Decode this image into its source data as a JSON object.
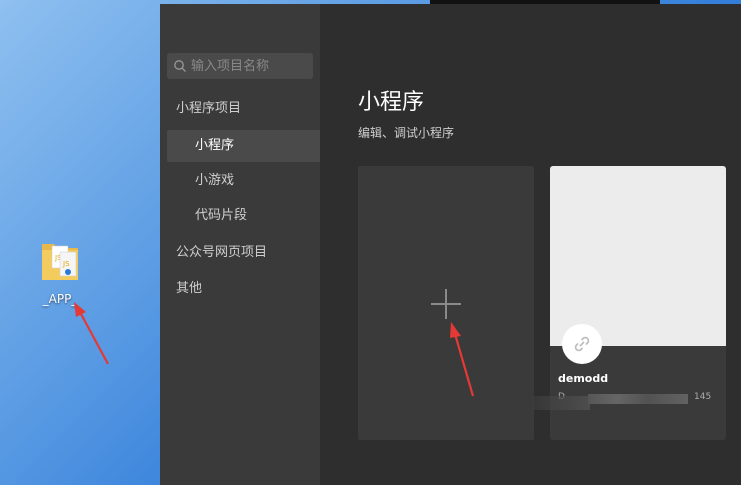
{
  "desktop": {
    "icon_label": "_APP_"
  },
  "sidebar": {
    "search_placeholder": "输入项目名称",
    "items": [
      {
        "label": "小程序项目"
      },
      {
        "label": "小程序"
      },
      {
        "label": "小游戏"
      },
      {
        "label": "代码片段"
      },
      {
        "label": "公众号网页项目"
      },
      {
        "label": "其他"
      }
    ]
  },
  "main": {
    "title": "小程序",
    "subtitle": "编辑、调试小程序",
    "project": {
      "name": "demodd",
      "meta_prefix": "D",
      "meta_suffix": "145"
    }
  },
  "colors": {
    "desktop_blue": "#2a78d8",
    "sidebar_bg": "#3a3a3a",
    "main_bg": "#2e2e2e",
    "annotation_arrow": "#e53935"
  }
}
